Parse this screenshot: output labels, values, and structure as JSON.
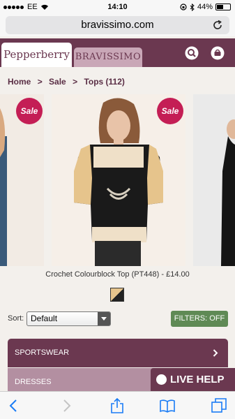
{
  "status": {
    "carrier": "EE",
    "time": "14:10",
    "battery": "44%"
  },
  "browser": {
    "url": "bravissimo.com"
  },
  "header": {
    "tab_pepperberry": "Pepperberry",
    "tab_bravissimo": "BRAVISSIMO"
  },
  "breadcrumb": {
    "home": "Home",
    "sep1": ">",
    "sale": "Sale",
    "sep2": ">",
    "tops": "Tops (112)"
  },
  "carousel": {
    "badge": "Sale"
  },
  "product": {
    "caption": "Crochet Colourblock Top (PT448) - £14.00"
  },
  "sort": {
    "label": "Sort:",
    "value": "Default"
  },
  "filters": {
    "label": "FILTERS: OFF"
  },
  "categories": [
    {
      "label": "SPORTSWEAR"
    },
    {
      "label": "DRESSES"
    }
  ],
  "live_help": {
    "label": "LIVE HELP"
  },
  "colors": {
    "brand": "#6b3850",
    "sale": "#c41e55",
    "filters": "#5f8a55"
  },
  "icons": [
    "wifi-icon",
    "bluetooth-icon",
    "reload-icon",
    "search-icon",
    "basket-icon",
    "chevron-right-icon",
    "back-icon",
    "forward-icon",
    "share-icon",
    "bookmarks-icon",
    "tabs-icon"
  ]
}
